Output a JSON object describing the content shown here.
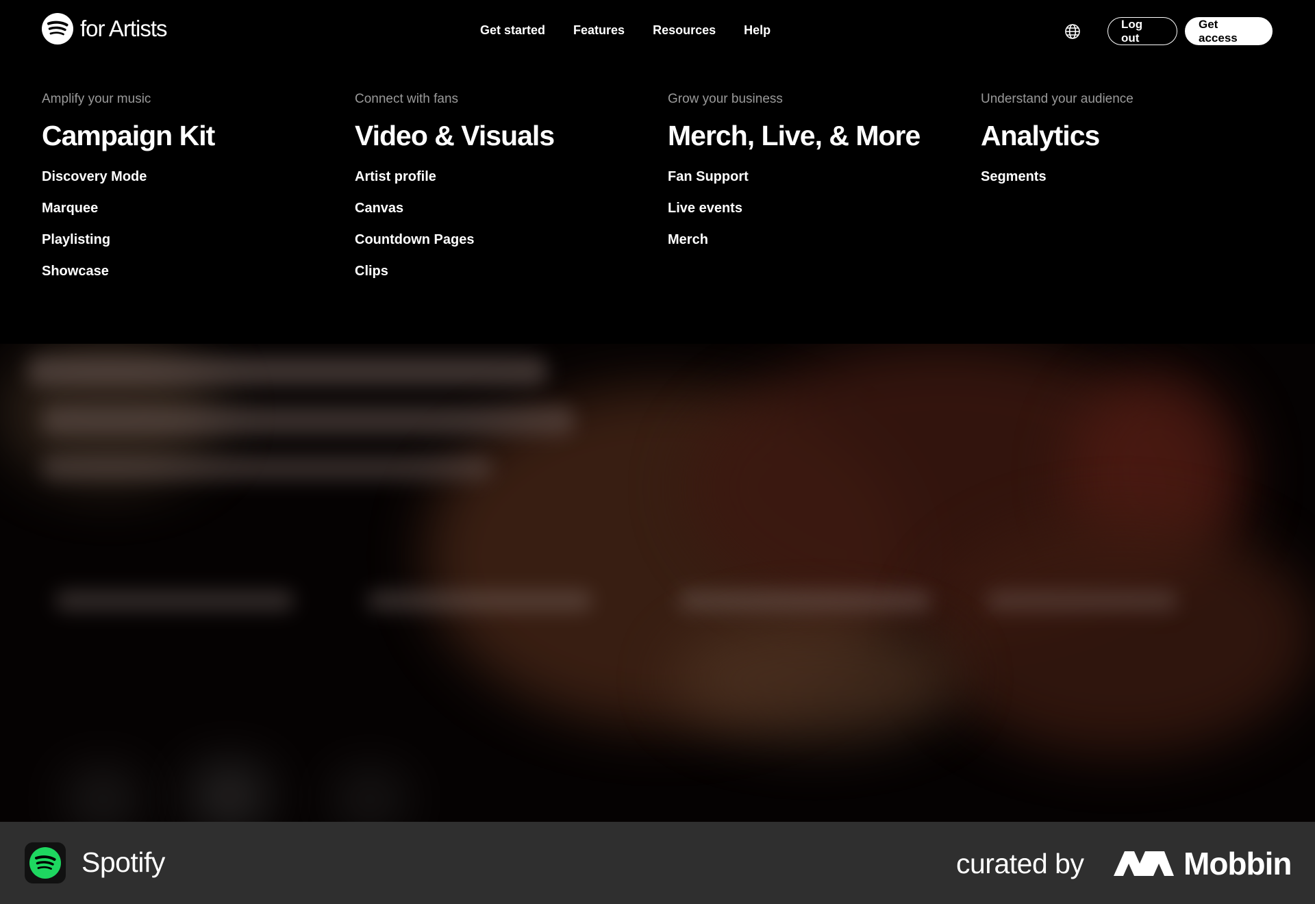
{
  "header": {
    "brand": "for Artists",
    "nav": [
      "Get started",
      "Features",
      "Resources",
      "Help"
    ],
    "logout_label": "Log out",
    "get_access_label": "Get access"
  },
  "menu": {
    "columns": [
      {
        "subtitle": "Amplify your music",
        "title": "Campaign Kit",
        "links": [
          "Discovery Mode",
          "Marquee",
          "Playlisting",
          "Showcase"
        ]
      },
      {
        "subtitle": "Connect with fans",
        "title": "Video & Visuals",
        "links": [
          "Artist profile",
          "Canvas",
          "Countdown Pages",
          "Clips"
        ]
      },
      {
        "subtitle": "Grow your business",
        "title": "Merch, Live, & More",
        "links": [
          "Fan Support",
          "Live events",
          "Merch"
        ]
      },
      {
        "subtitle": "Understand your audience",
        "title": "Analytics",
        "links": [
          "Segments"
        ]
      }
    ]
  },
  "footer": {
    "app_name": "Spotify",
    "curated_by": "curated by",
    "brand": "Mobbin"
  },
  "colors": {
    "background": "#000000",
    "footer_bg": "#2f2f2f",
    "spotify_green": "#1ed760",
    "muted_text": "#9a9a9a"
  },
  "icons": [
    "spotify-logo-icon",
    "globe-icon",
    "mobbin-logo-icon"
  ]
}
